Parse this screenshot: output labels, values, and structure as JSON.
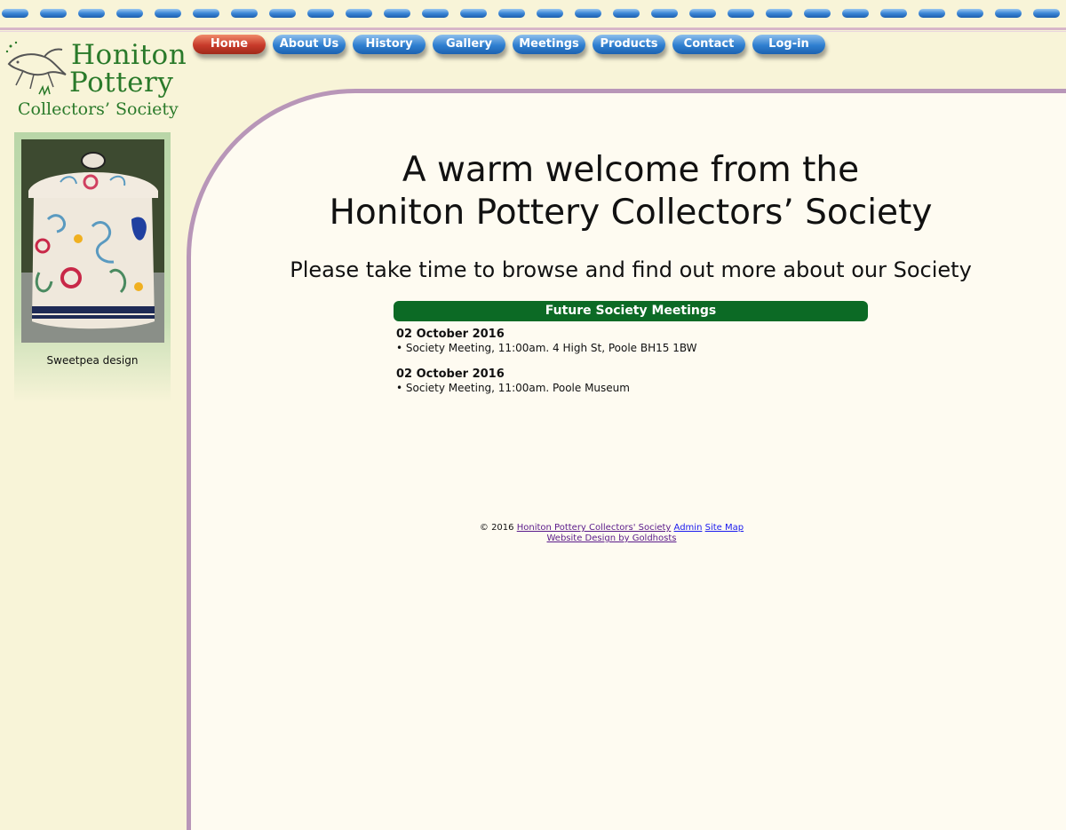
{
  "logo": {
    "line1": "Honiton",
    "line2": "Pottery",
    "line3": "Collectors’ Society"
  },
  "nav": [
    {
      "label": "Home",
      "active": true
    },
    {
      "label": "About Us"
    },
    {
      "label": "History"
    },
    {
      "label": "Gallery"
    },
    {
      "label": "Meetings"
    },
    {
      "label": "Products"
    },
    {
      "label": "Contact"
    },
    {
      "label": "Log-in"
    }
  ],
  "sidebar": {
    "caption": "Sweetpea design"
  },
  "main": {
    "welcome_line1": "A warm welcome from the",
    "welcome_line2": "Honiton Pottery Collectors’ Society",
    "tagline": "Please take time to browse and find out more about our Society"
  },
  "meetings": {
    "heading": "Future Society Meetings",
    "items": [
      {
        "date": "02 October 2016",
        "desc": "• Society Meeting, 11:00am. 4 High St, Poole BH15 1BW"
      },
      {
        "date": "02 October 2016",
        "desc": "• Society Meeting, 11:00am. Poole Museum"
      }
    ]
  },
  "footer": {
    "copyright": "© 2016",
    "society_link": "Honiton Pottery Collectors' Society",
    "admin_link": "Admin",
    "sitemap_link": "Site Map",
    "design_link": "Website Design by Goldhosts"
  },
  "colors": {
    "background": "#f8f4d8",
    "main_panel": "#fefbf1",
    "border_purple": "#b896b8",
    "logo_green": "#2a7a2a",
    "meeting_header_green": "#0c6a25",
    "nav_blue": "#2f7fd0",
    "nav_active_red": "#c73a2a"
  }
}
